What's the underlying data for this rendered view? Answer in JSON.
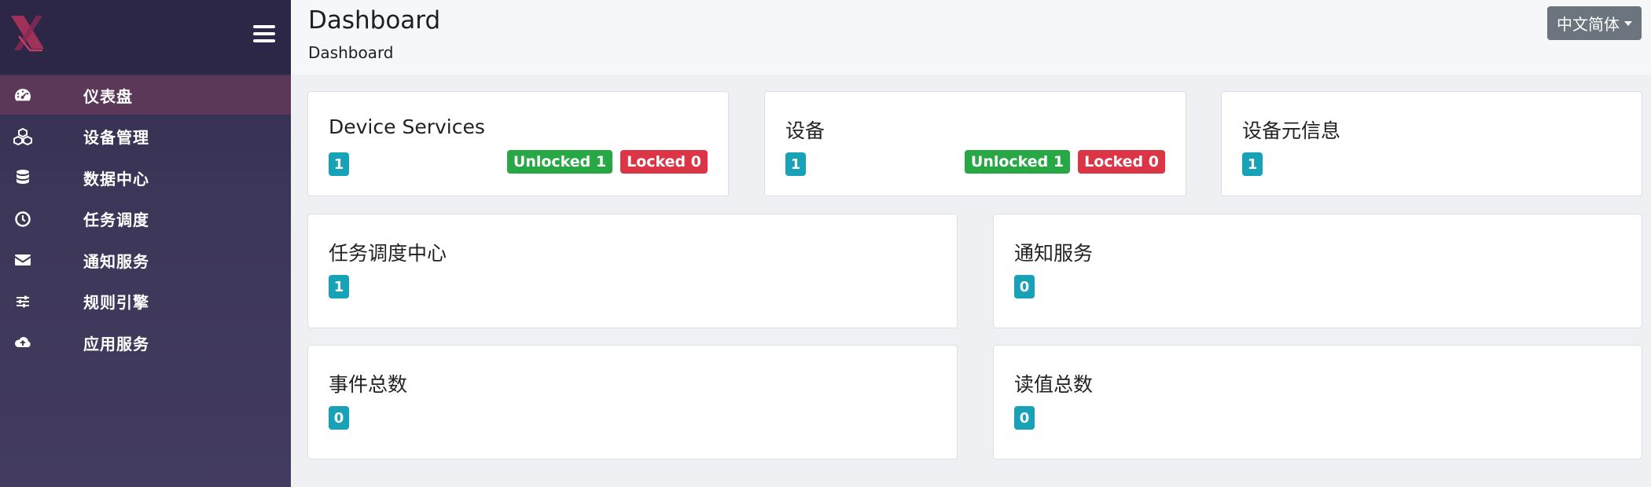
{
  "sidebar": {
    "logo_icon": "x-logo-icon",
    "menu_icon": "hamburger-icon",
    "items": [
      {
        "label": "仪表盘",
        "icon": "dashboard-gauge-icon",
        "active": true
      },
      {
        "label": "设备管理",
        "icon": "cubes-icon",
        "active": false
      },
      {
        "label": "数据中心",
        "icon": "database-icon",
        "active": false
      },
      {
        "label": "任务调度",
        "icon": "clock-icon",
        "active": false
      },
      {
        "label": "通知服务",
        "icon": "envelope-icon",
        "active": false
      },
      {
        "label": "规则引擎",
        "icon": "sliders-icon",
        "active": false
      },
      {
        "label": "应用服务",
        "icon": "cloud-upload-icon",
        "active": false
      }
    ]
  },
  "header": {
    "title": "Dashboard",
    "breadcrumb": "Dashboard",
    "language": "中文简体"
  },
  "cards": {
    "device_services": {
      "title": "Device Services",
      "count": "1",
      "unlocked": "Unlocked 1",
      "locked": "Locked 0"
    },
    "devices": {
      "title": "设备",
      "count": "1",
      "unlocked": "Unlocked 1",
      "locked": "Locked 0"
    },
    "device_metadata": {
      "title": "设备元信息",
      "count": "1"
    },
    "scheduler_center": {
      "title": "任务调度中心",
      "count": "1"
    },
    "notification_service": {
      "title": "通知服务",
      "count": "0"
    },
    "event_total": {
      "title": "事件总数",
      "count": "0"
    },
    "reading_total": {
      "title": "读值总数",
      "count": "0"
    }
  },
  "colors": {
    "sidebar_bg": "#3c3658",
    "active_item": "#5b3858",
    "count_badge": "#17a2b8",
    "unlocked_badge": "#28a745",
    "locked_badge": "#dc3545",
    "language_button": "#6c757d"
  }
}
